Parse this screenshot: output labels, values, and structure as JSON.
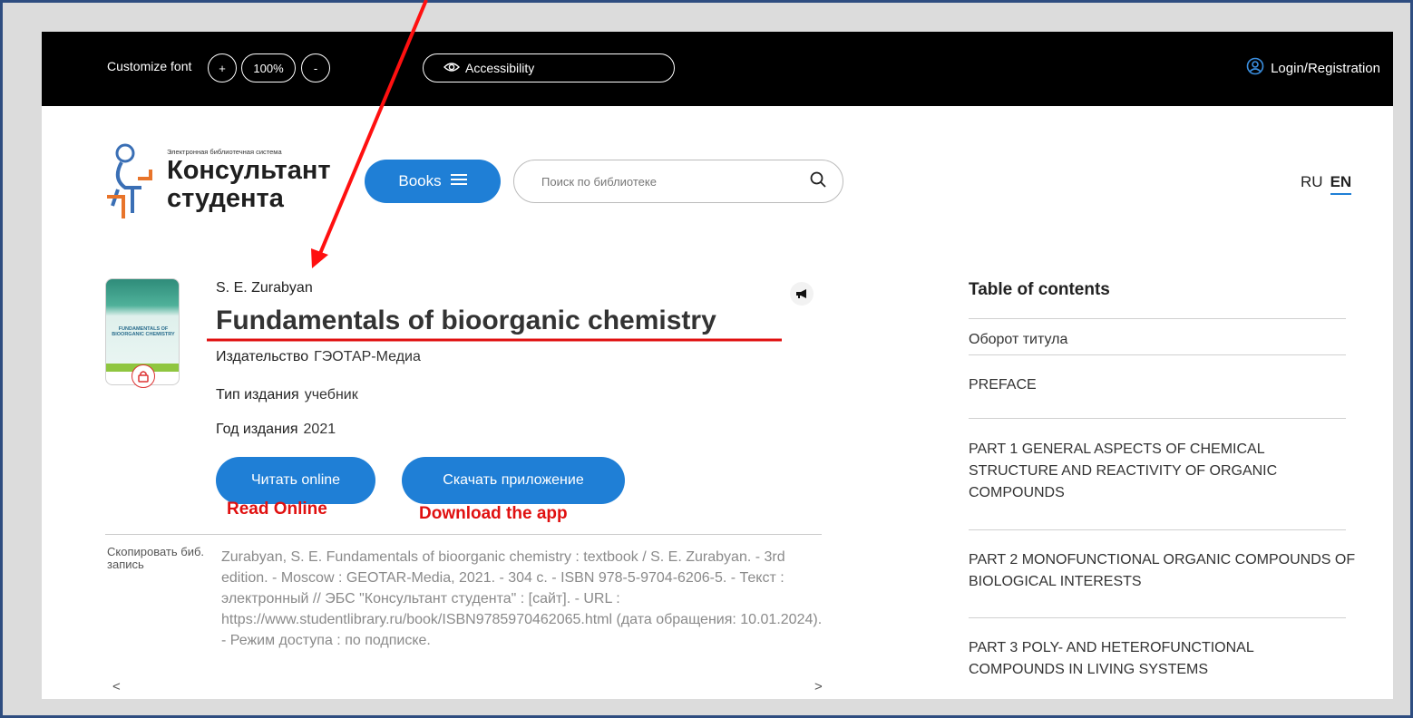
{
  "topbar": {
    "customize_font_label": "Customize font",
    "increase_font": "+",
    "font_scale": "100%",
    "decrease_font": "-",
    "accessibility_label": "Accessibility",
    "login_label": "Login/Registration"
  },
  "header": {
    "logo_subtitle": "Электронная библиотечная система",
    "logo_line1": "Консультант",
    "logo_line2": "студента",
    "books_label": "Books",
    "search_placeholder": "Поиск по библиотеке",
    "lang_ru": "RU",
    "lang_en": "EN"
  },
  "book": {
    "cover_text": "FUNDAMENTALS OF BIOORGANIC CHEMISTRY",
    "author": "S. E. Zurabyan",
    "title": "Fundamentals of bioorganic chemistry",
    "publisher_label": "Издательство",
    "publisher_value": "ГЭОТАР-Медиа",
    "type_label": "Тип издания",
    "type_value": "учебник",
    "year_label": "Год издания",
    "year_value": "2021",
    "read_online_button": "Читать online",
    "download_app_button": "Скачать приложение"
  },
  "annotations": {
    "read_online": "Read Online",
    "download_app": "Download the app",
    "color": "#e01010"
  },
  "citation": {
    "copy_label": "Скопировать биб. запись",
    "text": "Zurabyan, S. E. Fundamentals of bioorganic chemistry : textbook / S. E. Zurabyan. - 3rd edition. - Moscow : GEOTAR-Media, 2021. - 304 с. - ISBN 978-5-9704-6206-5. - Текст : электронный // ЭБС \"Консультант студента\" : [сайт]. - URL : https://www.studentlibrary.ru/book/ISBN9785970462065.html (дата обращения: 10.01.2024). - Режим доступа : по подписке.",
    "scroll_left": "<",
    "scroll_right": ">"
  },
  "toc": {
    "title": "Table of contents",
    "items": [
      "Оборот титула",
      "PREFACE",
      "PART 1 GENERAL ASPECTS OF CHEMICAL STRUCTURE AND REACTIVITY OF ORGANIC COMPOUNDS",
      "PART 2 MONOFUNCTIONAL ORGANIC COMPOUNDS OF BIOLOGICAL INTERESTS",
      "PART 3 POLY- AND HETEROFUNCTIONAL COMPOUNDS IN LIVING SYSTEMS"
    ]
  },
  "colors": {
    "accent": "#1f7fd6",
    "topbar": "#000000",
    "frame": "#2e4d80"
  }
}
